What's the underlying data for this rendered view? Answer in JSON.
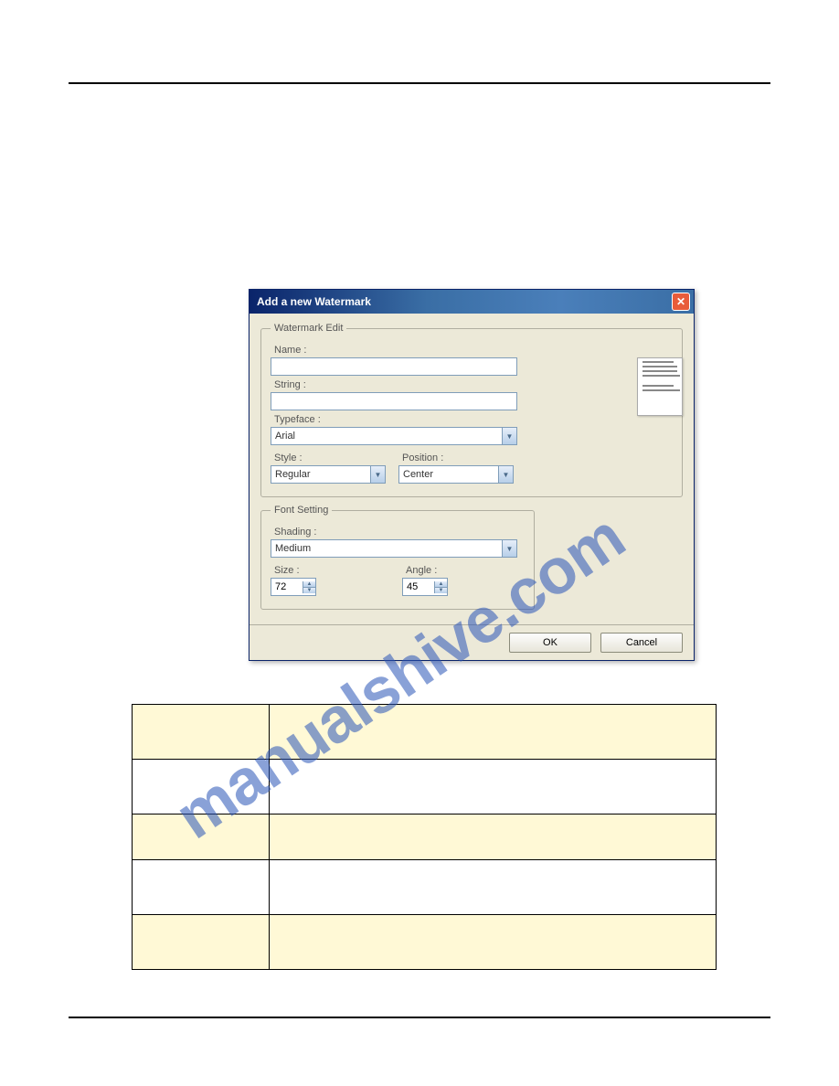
{
  "dialog": {
    "title": "Add a new Watermark",
    "group_edit": "Watermark Edit",
    "group_font": "Font Setting",
    "labels": {
      "name": "Name :",
      "string": "String :",
      "typeface": "Typeface :",
      "style": "Style :",
      "position": "Position :",
      "shading": "Shading :",
      "size": "Size :",
      "angle": "Angle :"
    },
    "values": {
      "name": "",
      "string": "",
      "typeface": "Arial",
      "style": "Regular",
      "position": "Center",
      "shading": "Medium",
      "size": "72",
      "angle": "45"
    },
    "buttons": {
      "ok": "OK",
      "cancel": "Cancel"
    }
  },
  "watermark_overlay": "manualshive.com",
  "table": {
    "rows": [
      {
        "label": "",
        "desc": ""
      },
      {
        "label": "",
        "desc": ""
      },
      {
        "label": "",
        "desc": ""
      },
      {
        "label": "",
        "desc": ""
      },
      {
        "label": "",
        "desc": ""
      }
    ]
  }
}
